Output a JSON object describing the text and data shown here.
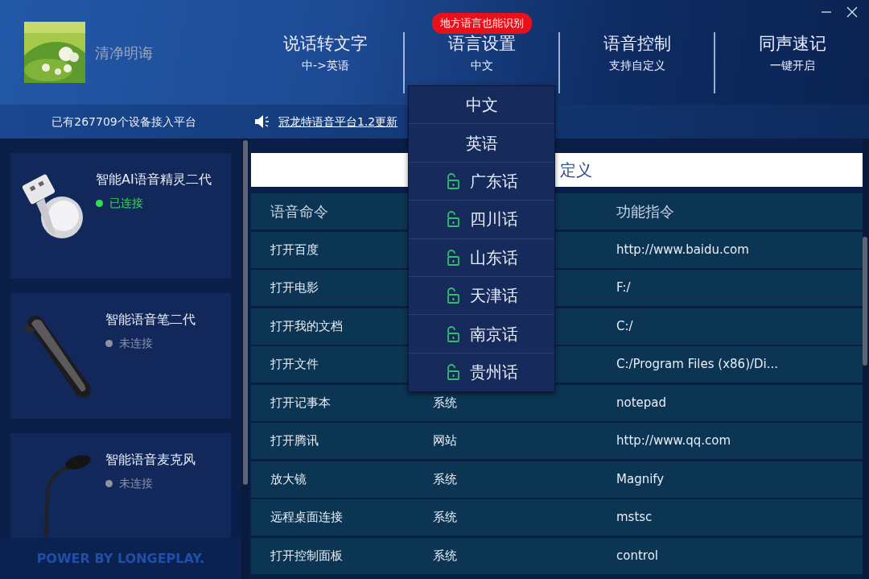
{
  "user": {
    "name": "清净明诲"
  },
  "nav_tabs": [
    {
      "title": "说话转文字",
      "subtitle": "中->英语"
    },
    {
      "title": "语言设置",
      "subtitle": "中文",
      "badge": "地方语言也能识别"
    },
    {
      "title": "语音控制",
      "subtitle": "支持自定义"
    },
    {
      "title": "同声速记",
      "subtitle": "一键开启"
    }
  ],
  "device_count": "已有267709个设备接入平台",
  "announcement": "冠龙特语音平台1.2更新",
  "devices": [
    {
      "name": "智能AI语音精灵二代",
      "status": "已连接",
      "connected": true,
      "kind": "usb"
    },
    {
      "name": "智能语音笔二代",
      "status": "未连接",
      "connected": false,
      "kind": "earpiece"
    },
    {
      "name": "智能语音麦克风",
      "status": "未连接",
      "connected": false,
      "kind": "microphone"
    }
  ],
  "footer": "POWER BY LONGEPLAY.",
  "panel_title": "定义",
  "table": {
    "column_1": "语音命令",
    "column_3": "功能指令",
    "rows": [
      {
        "command": "打开百度",
        "action": "http://www.baidu.com"
      },
      {
        "command": "打开电影",
        "action": "F:/"
      },
      {
        "command": "打开我的文档",
        "action": "C:/"
      },
      {
        "command": "打开文件",
        "action": "C:/Program Files (x86)/Di..."
      },
      {
        "command": "打开记事本",
        "type": "系统",
        "action": "notepad"
      },
      {
        "command": "打开腾讯",
        "type": "网站",
        "action": "http://www.qq.com"
      },
      {
        "command": "放大镜",
        "type": "系统",
        "action": "Magnify"
      },
      {
        "command": "远程桌面连接",
        "type": "系统",
        "action": "mstsc"
      },
      {
        "command": "打开控制面板",
        "type": "系统",
        "action": "control"
      }
    ]
  },
  "language_menu": {
    "items": [
      {
        "label": "中文",
        "kind": "plain"
      },
      {
        "label": "英语",
        "kind": "plain"
      },
      {
        "label": "广东话",
        "kind": "dialect"
      },
      {
        "label": "四川话",
        "kind": "dialect"
      },
      {
        "label": "山东话",
        "kind": "dialect"
      },
      {
        "label": "天津话",
        "kind": "dialect"
      },
      {
        "label": "南京话",
        "kind": "dialect"
      },
      {
        "label": "贵州话",
        "kind": "dialect"
      }
    ]
  }
}
